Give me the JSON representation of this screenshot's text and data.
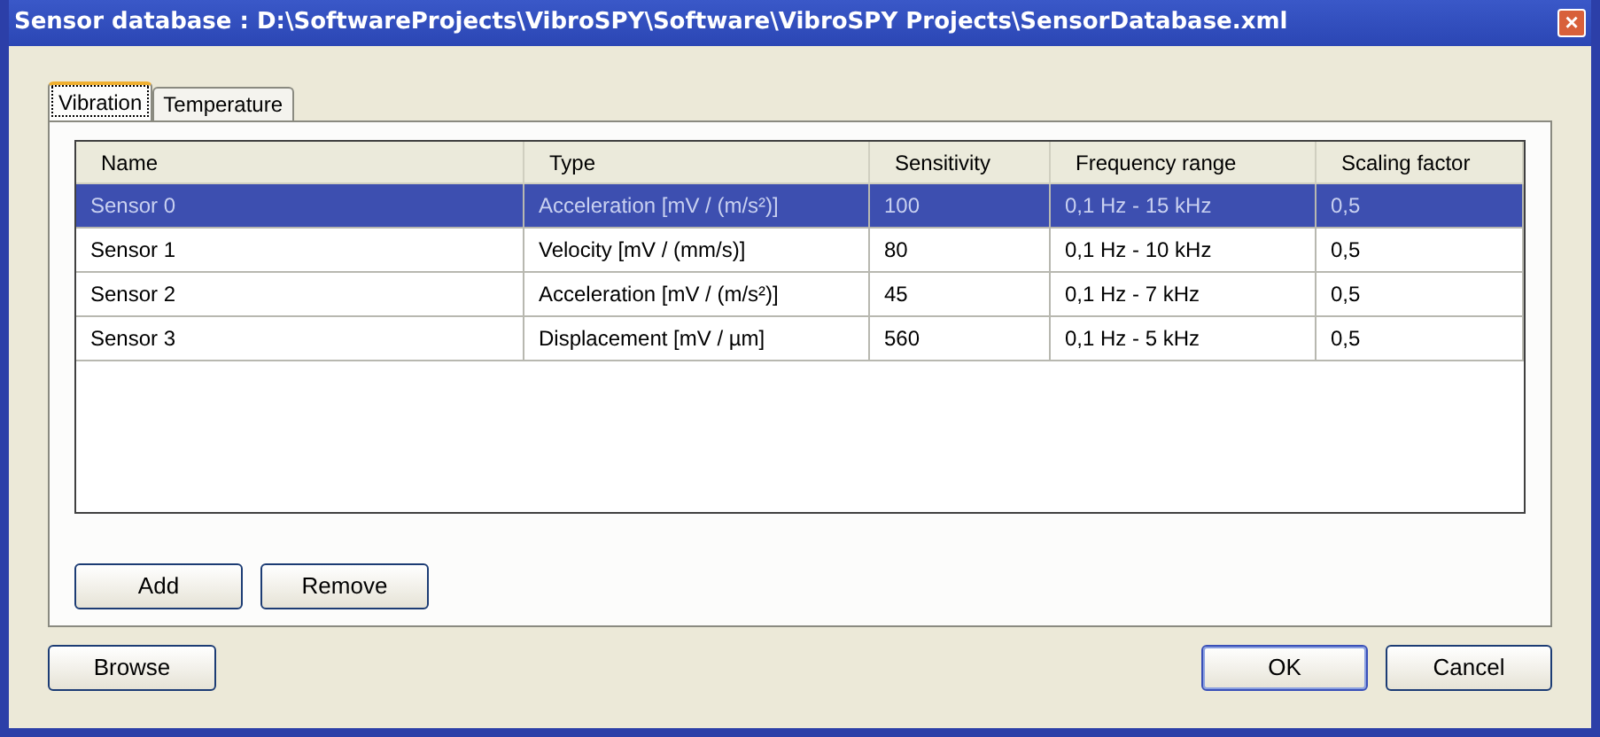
{
  "window": {
    "title": "Sensor database : D:\\SoftwareProjects\\VibroSPY\\Software\\VibroSPY Projects\\SensorDatabase.xml",
    "close": "×"
  },
  "tabs": [
    {
      "label": "Vibration",
      "selected": true
    },
    {
      "label": "Temperature",
      "selected": false
    }
  ],
  "table": {
    "columns": [
      "Name",
      "Type",
      "Sensitivity",
      "Frequency range",
      "Scaling factor"
    ],
    "rows": [
      {
        "cells": [
          "Sensor 0",
          "Acceleration [mV / (m/s²)]",
          "100",
          "0,1 Hz - 15 kHz",
          "0,5"
        ],
        "selected": true
      },
      {
        "cells": [
          "Sensor 1",
          "Velocity [mV / (mm/s)]",
          "80",
          "0,1 Hz - 10 kHz",
          "0,5"
        ],
        "selected": false
      },
      {
        "cells": [
          "Sensor 2",
          "Acceleration [mV / (m/s²)]",
          "45",
          "0,1 Hz - 7 kHz",
          "0,5"
        ],
        "selected": false
      },
      {
        "cells": [
          "Sensor 3",
          "Displacement [mV / µm]",
          "560",
          "0,1 Hz - 5 kHz",
          "0,5"
        ],
        "selected": false
      }
    ]
  },
  "panel_buttons": [
    "Add",
    "Remove"
  ],
  "footer": {
    "left": [
      "Browse"
    ],
    "right": [
      {
        "label": "OK",
        "default": true
      },
      {
        "label": "Cancel",
        "default": false
      }
    ]
  }
}
